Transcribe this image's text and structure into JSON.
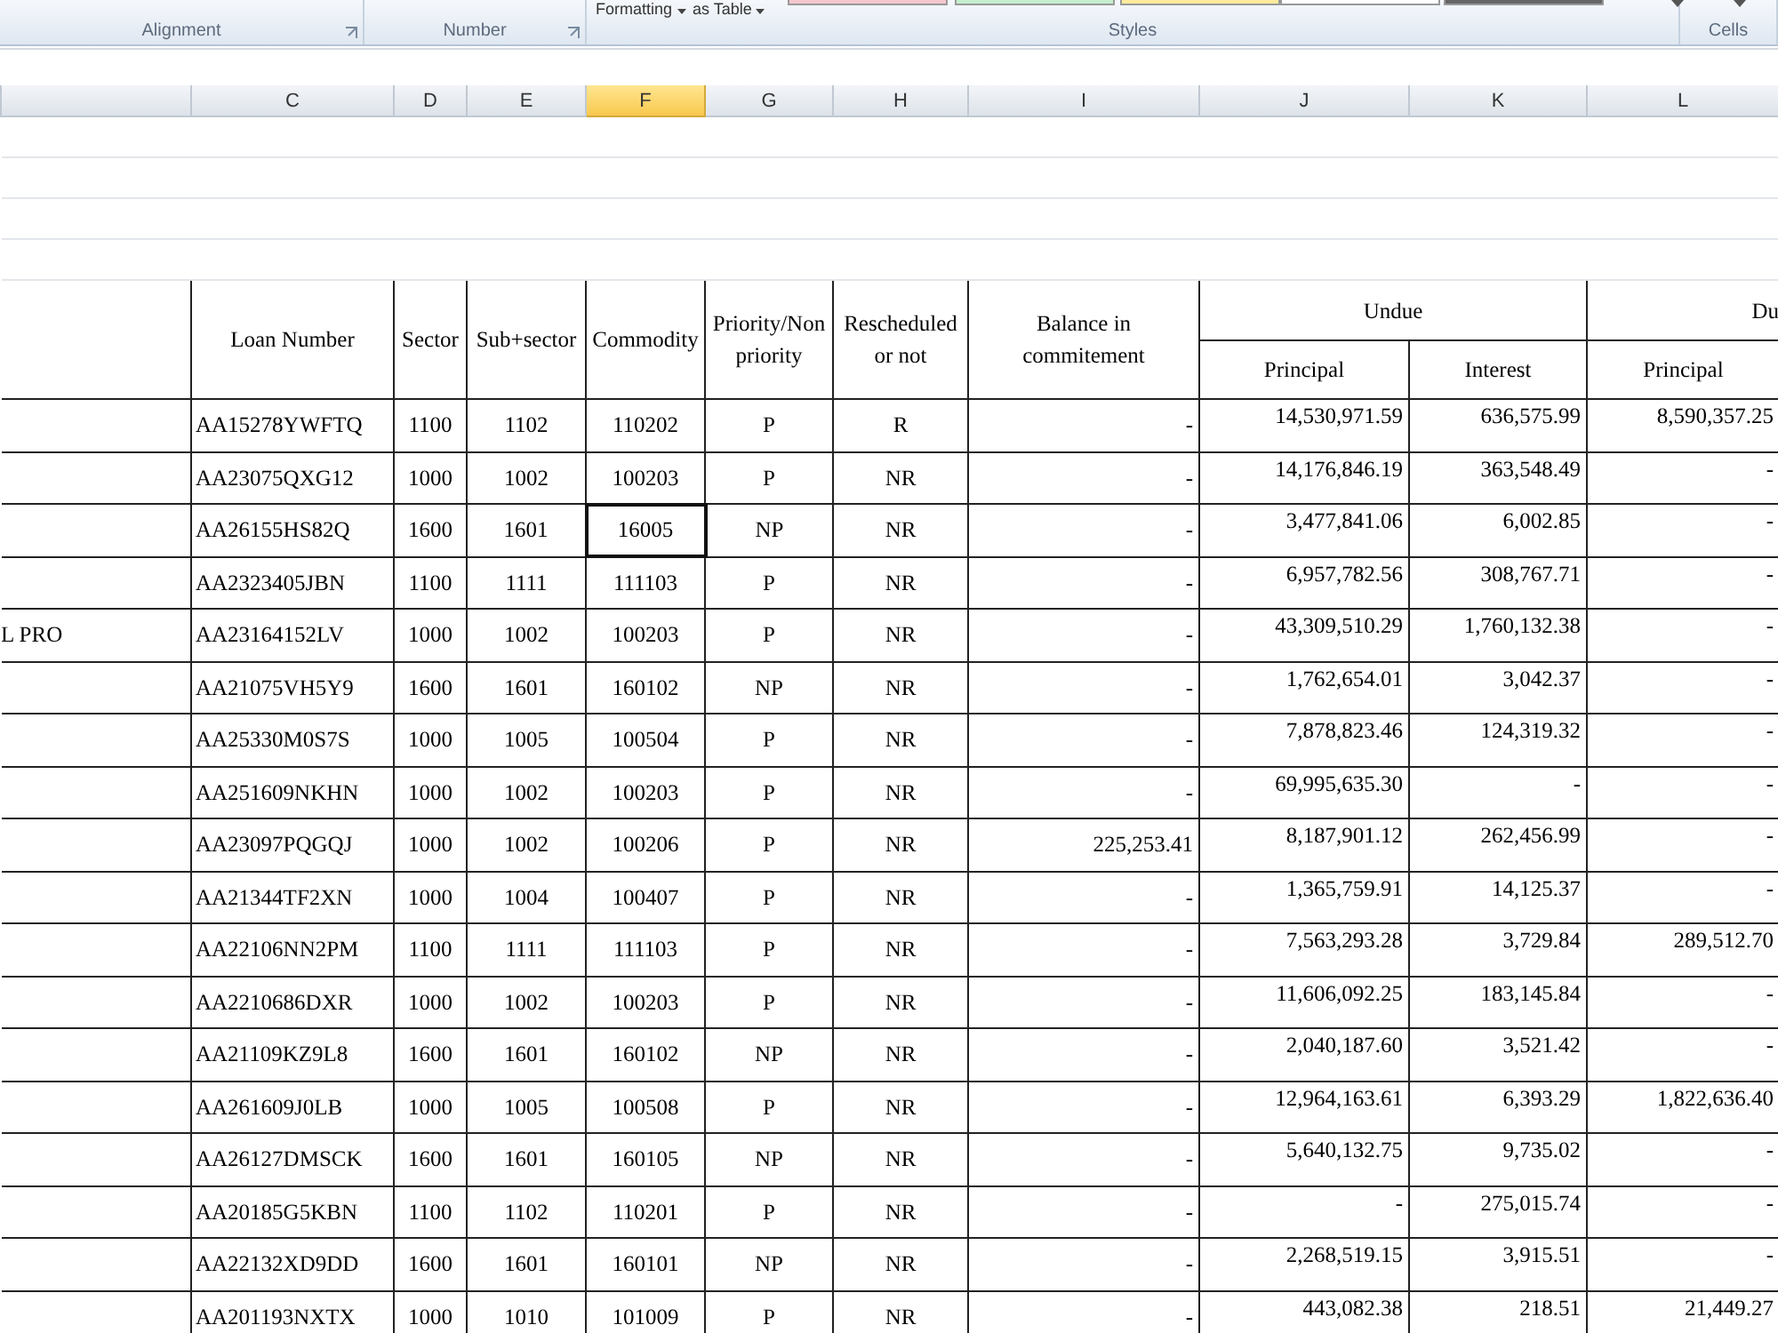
{
  "ribbon": {
    "partial_labels": [
      "Formatting",
      "as Table"
    ],
    "groups": [
      {
        "label": "Alignment",
        "launcher": true
      },
      {
        "label": "Number",
        "launcher": true
      },
      {
        "label": "Styles",
        "launcher": false
      },
      {
        "label": "Cells",
        "launcher": false
      }
    ]
  },
  "column_headers": [
    {
      "selected": false
    },
    {
      "label": "C",
      "selected": false
    },
    {
      "label": "D",
      "selected": false
    },
    {
      "label": "E",
      "selected": false
    },
    {
      "label": "F",
      "selected": true
    },
    {
      "label": "G",
      "selected": false
    },
    {
      "label": "H",
      "selected": false
    },
    {
      "label": "I",
      "selected": false
    },
    {
      "label": "J",
      "selected": false
    },
    {
      "label": "K",
      "selected": false
    },
    {
      "label": "L",
      "selected": false
    }
  ],
  "table_header": {
    "loan_number": "Loan Number",
    "sector": "Sector",
    "sub_sector": "Sub+sector",
    "commodity": "Commodity",
    "priority": "Priority/Non priority",
    "rescheduled": "Rescheduled or not",
    "balance": "Balance  in commitement",
    "undue": "Undue",
    "undue_principal": "Principal",
    "undue_interest": "Interest",
    "due": "Du",
    "due_principal": "Principal"
  },
  "rows": [
    {
      "selected": false,
      "cells": [
        "",
        "AA15278YWFTQ",
        "1100",
        "1102",
        "110202",
        "P",
        "R",
        "-",
        "14,530,971.59",
        "636,575.99",
        "8,590,357.25"
      ]
    },
    {
      "selected": false,
      "cells": [
        "",
        "AA23075QXG12",
        "1000",
        "1002",
        "100203",
        "P",
        "NR",
        "-",
        "14,176,846.19",
        "363,548.49",
        "-"
      ]
    },
    {
      "selected": true,
      "cells": [
        "",
        "AA26155HS82Q",
        "1600",
        "1601",
        "16005",
        "NP",
        "NR",
        "-",
        "3,477,841.06",
        "6,002.85",
        "-"
      ]
    },
    {
      "selected": false,
      "cells": [
        "",
        "AA2323405JBN",
        "1100",
        "1111",
        "111103",
        "P",
        "NR",
        "-",
        "6,957,782.56",
        "308,767.71",
        "-"
      ]
    },
    {
      "selected": false,
      "cells": [
        "L PRO",
        "AA23164152LV",
        "1000",
        "1002",
        "100203",
        "P",
        "NR",
        "-",
        "43,309,510.29",
        "1,760,132.38",
        "-"
      ]
    },
    {
      "selected": false,
      "cells": [
        "",
        "AA21075VH5Y9",
        "1600",
        "1601",
        "160102",
        "NP",
        "NR",
        "-",
        "1,762,654.01",
        "3,042.37",
        "-"
      ]
    },
    {
      "selected": false,
      "cells": [
        "",
        "AA25330M0S7S",
        "1000",
        "1005",
        "100504",
        "P",
        "NR",
        "-",
        "7,878,823.46",
        "124,319.32",
        "-"
      ]
    },
    {
      "selected": false,
      "cells": [
        "",
        "AA251609NKHN",
        "1000",
        "1002",
        "100203",
        "P",
        "NR",
        "-",
        "69,995,635.30",
        "-",
        "-"
      ]
    },
    {
      "selected": false,
      "cells": [
        "",
        "AA23097PQGQJ",
        "1000",
        "1002",
        "100206",
        "P",
        "NR",
        "225,253.41",
        "8,187,901.12",
        "262,456.99",
        "-"
      ]
    },
    {
      "selected": false,
      "cells": [
        "",
        "AA21344TF2XN",
        "1000",
        "1004",
        "100407",
        "P",
        "NR",
        "-",
        "1,365,759.91",
        "14,125.37",
        "-"
      ]
    },
    {
      "selected": false,
      "cells": [
        "",
        "AA22106NN2PM",
        "1100",
        "1111",
        "111103",
        "P",
        "NR",
        "-",
        "7,563,293.28",
        "3,729.84",
        "289,512.70"
      ]
    },
    {
      "selected": false,
      "cells": [
        "",
        "AA2210686DXR",
        "1000",
        "1002",
        "100203",
        "P",
        "NR",
        "-",
        "11,606,092.25",
        "183,145.84",
        "-"
      ]
    },
    {
      "selected": false,
      "cells": [
        "",
        "AA21109KZ9L8",
        "1600",
        "1601",
        "160102",
        "NP",
        "NR",
        "-",
        "2,040,187.60",
        "3,521.42",
        "-"
      ]
    },
    {
      "selected": false,
      "cells": [
        "",
        "AA261609J0LB",
        "1000",
        "1005",
        "100508",
        "P",
        "NR",
        "-",
        "12,964,163.61",
        "6,393.29",
        "1,822,636.40"
      ]
    },
    {
      "selected": false,
      "cells": [
        "",
        "AA26127DMSCK",
        "1600",
        "1601",
        "160105",
        "NP",
        "NR",
        "-",
        "5,640,132.75",
        "9,735.02",
        "-"
      ]
    },
    {
      "selected": false,
      "cells": [
        "",
        "AA20185G5KBN",
        "1100",
        "1102",
        "110201",
        "P",
        "NR",
        "-",
        "-",
        "275,015.74",
        "-"
      ]
    },
    {
      "selected": false,
      "cells": [
        "",
        "AA22132XD9DD",
        "1600",
        "1601",
        "160101",
        "NP",
        "NR",
        "-",
        "2,268,519.15",
        "3,915.51",
        "-"
      ]
    },
    {
      "selected": false,
      "cells": [
        "",
        "AA201193NXTX",
        "1000",
        "1010",
        "101009",
        "P",
        "NR",
        "-",
        "443,082.38",
        "218.51",
        "21,449.27"
      ]
    }
  ]
}
